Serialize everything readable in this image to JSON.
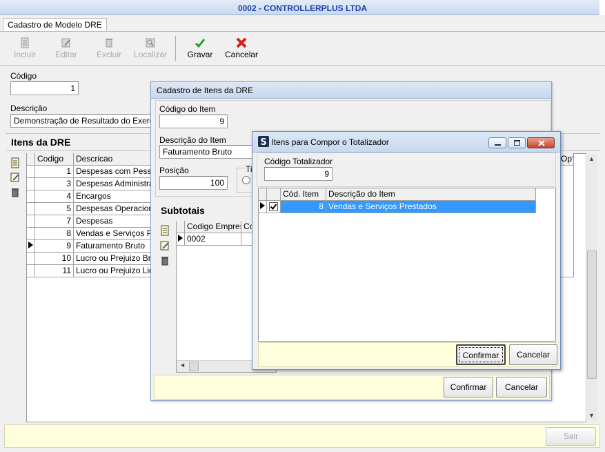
{
  "window": {
    "title": "0002 - CONTROLLERPLUS LTDA"
  },
  "tab": {
    "label": "Cadastro de Modelo DRE"
  },
  "toolbar": {
    "incluir": "Incluir",
    "editar": "Editar",
    "excluir": "Excluir",
    "localizar": "Localizar",
    "gravar": "Gravar",
    "cancelar": "Cancelar"
  },
  "form": {
    "codigo_label": "Código",
    "codigo_value": "1",
    "descricao_label": "Descrição",
    "descricao_value": "Demonstração de Resultado do Exercicio Â"
  },
  "itens": {
    "title": "Itens da DRE",
    "col_codigo": "Codigo",
    "col_descricao": "Descricao",
    "col_op": "Op?",
    "rows": [
      {
        "codigo": "1",
        "descricao": "Despesas com Pessoal"
      },
      {
        "codigo": "3",
        "descricao": "Despesas Administrativas"
      },
      {
        "codigo": "4",
        "descricao": "Encargos"
      },
      {
        "codigo": "5",
        "descricao": "Despesas Operacionais"
      },
      {
        "codigo": "7",
        "descricao": "Despesas"
      },
      {
        "codigo": "8",
        "descricao": "Vendas e Serviços Prestados"
      },
      {
        "codigo": "9",
        "descricao": "Faturamento Bruto"
      },
      {
        "codigo": "10",
        "descricao": "Lucro ou Prejuizo Bruto"
      },
      {
        "codigo": "11",
        "descricao": "Lucro ou Prejuizo Liquido"
      }
    ]
  },
  "footer": {
    "sair": "Sair"
  },
  "dialog_itens": {
    "title": "Cadastro de Itens da DRE",
    "codigo_label": "Código do Item",
    "codigo_value": "9",
    "descricao_label": "Descrição do Item",
    "descricao_value": "Faturamento Bruto",
    "posicao_label": "Posição",
    "posicao_value": "100",
    "tipo_label": "Ti",
    "subtotais_title": "Subtotais",
    "col_empresa": "Codigo Empresa",
    "col_co": "Co",
    "row_empresa": "0002",
    "confirmar": "Confirmar",
    "cancelar": "Cancelar"
  },
  "dialog_totalizador": {
    "title": "Itens para Compor o Totalizador",
    "codigo_label": "Código Totalizador",
    "codigo_value": "9",
    "col_cod": "Cód. Item",
    "col_desc": "Descrição do Item",
    "row_cod": "8",
    "row_desc": "Vendas e Serviços Prestados",
    "confirmar": "Confirmar",
    "cancelar": "Cancelar"
  }
}
